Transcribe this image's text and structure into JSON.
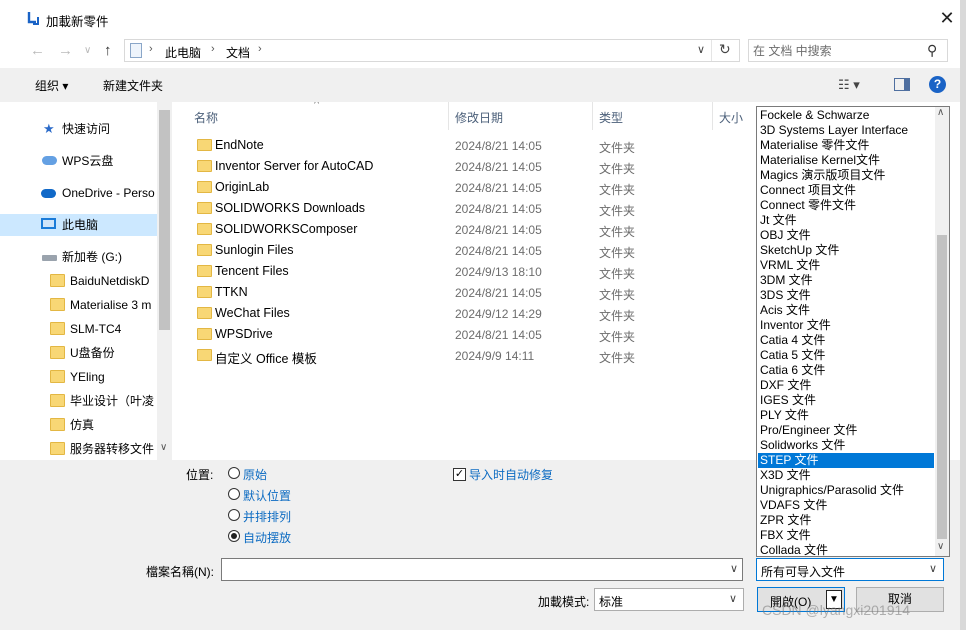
{
  "window": {
    "title": "加載新零件",
    "close_glyph": "✕"
  },
  "nav": {
    "back": "←",
    "forward": "→",
    "recent": "∨",
    "up": "↑",
    "breadcrumb": [
      "此电脑",
      "文档"
    ],
    "search_placeholder": "在 文档 中搜索"
  },
  "toolbar": {
    "organize": "组织 ▾",
    "new_folder": "新建文件夹"
  },
  "sidebar": {
    "items": [
      {
        "label": "快速访问",
        "icon": "star"
      },
      {
        "label": "WPS云盘",
        "icon": "cloud"
      },
      {
        "label": "OneDrive - Perso",
        "icon": "onedrive"
      },
      {
        "label": "此电脑",
        "icon": "computer"
      },
      {
        "label": "新加卷 (G:)",
        "icon": "drive"
      },
      {
        "label": "BaiduNetdiskD",
        "icon": "folder"
      },
      {
        "label": "Materialise 3 m",
        "icon": "folder"
      },
      {
        "label": "SLM-TC4",
        "icon": "folder"
      },
      {
        "label": "U盘备份",
        "icon": "folder"
      },
      {
        "label": "YEling",
        "icon": "folder"
      },
      {
        "label": "毕业设计（叶凌",
        "icon": "folder"
      },
      {
        "label": "仿真",
        "icon": "folder"
      },
      {
        "label": "服务器转移文件",
        "icon": "folder"
      }
    ]
  },
  "filelist": {
    "columns": {
      "name": "名称",
      "modified": "修改日期",
      "type": "类型",
      "size": "大小"
    },
    "rows": [
      {
        "name": "EndNote",
        "modified": "2024/8/21 14:05",
        "type": "文件夹"
      },
      {
        "name": "Inventor Server for AutoCAD",
        "modified": "2024/8/21 14:05",
        "type": "文件夹"
      },
      {
        "name": "OriginLab",
        "modified": "2024/8/21 14:05",
        "type": "文件夹"
      },
      {
        "name": "SOLIDWORKS Downloads",
        "modified": "2024/8/21 14:05",
        "type": "文件夹"
      },
      {
        "name": "SOLIDWORKSComposer",
        "modified": "2024/8/21 14:05",
        "type": "文件夹"
      },
      {
        "name": "Sunlogin Files",
        "modified": "2024/8/21 14:05",
        "type": "文件夹"
      },
      {
        "name": "Tencent Files",
        "modified": "2024/9/13 18:10",
        "type": "文件夹"
      },
      {
        "name": "TTKN",
        "modified": "2024/8/21 14:05",
        "type": "文件夹"
      },
      {
        "name": "WeChat Files",
        "modified": "2024/9/12 14:29",
        "type": "文件夹"
      },
      {
        "name": "WPSDrive",
        "modified": "2024/8/21 14:05",
        "type": "文件夹"
      },
      {
        "name": "自定义 Office 模板",
        "modified": "2024/9/9 14:11",
        "type": "文件夹"
      }
    ]
  },
  "options": {
    "position_label": "位置:",
    "radios": [
      {
        "label": "原始",
        "checked": false
      },
      {
        "label": "默认位置",
        "checked": false
      },
      {
        "label": "并排排列",
        "checked": false
      },
      {
        "label": "自动摆放",
        "checked": true
      }
    ],
    "auto_repair_label": "导入时自动修复",
    "auto_repair_checked": true
  },
  "bottom": {
    "filename_label": "檔案名稱(N):",
    "filename_value": "",
    "filetype_value": "所有可导入文件",
    "mode_label": "加載模式:",
    "mode_value": "标准",
    "open_label": "開啟(O)",
    "cancel_label": "取消",
    "watermark": "CSDN @lyangxi201914"
  },
  "filetype_options": {
    "items": [
      "Fockele & Schwarze",
      "3D Systems Layer Interface",
      "Materialise 零件文件",
      "Materialise Kernel文件",
      "Magics 演示版项目文件",
      "Connect 项目文件",
      "Connect 零件文件",
      "Jt 文件",
      "OBJ 文件",
      "SketchUp 文件",
      "VRML 文件",
      "3DM 文件",
      "3DS 文件",
      "Acis 文件",
      "Inventor 文件",
      "Catia 4 文件",
      "Catia 5 文件",
      "Catia 6 文件",
      "DXF 文件",
      "IGES 文件",
      "PLY 文件",
      "Pro/Engineer 文件",
      "Solidworks 文件",
      "STEP 文件",
      "X3D 文件",
      "Unigraphics/Parasolid 文件",
      "VDAFS 文件",
      "ZPR 文件",
      "FBX 文件",
      "Collada 文件"
    ],
    "selected_index": 23
  },
  "colors": {
    "accent": "#0078d7",
    "selection": "#cce8ff",
    "folder": "#f8d775",
    "link": "#0c6bc2"
  }
}
